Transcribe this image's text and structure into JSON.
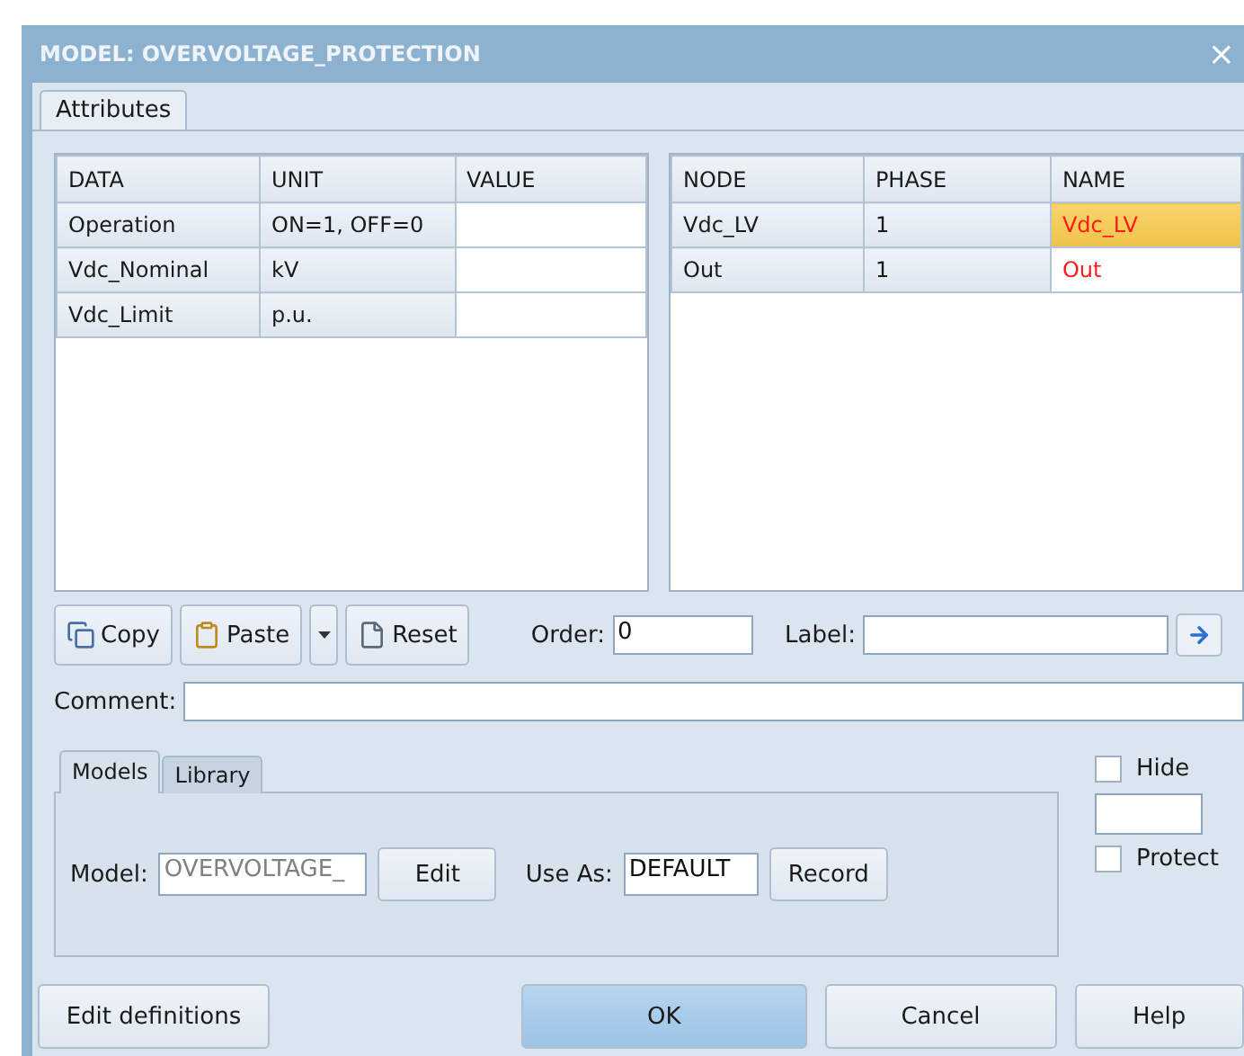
{
  "window": {
    "title": "MODEL: OVERVOLTAGE_PROTECTION",
    "close": "×"
  },
  "tabs": [
    {
      "label": "Attributes",
      "selected": true
    }
  ],
  "data_table": {
    "columns": [
      "DATA",
      "UNIT",
      "VALUE"
    ],
    "rows": [
      {
        "data": "Operation",
        "unit": "ON=1, OFF=0"
      },
      {
        "data": "Vdc_Nominal",
        "unit": "kV"
      },
      {
        "data": "Vdc_Limit",
        "unit": "p.u."
      }
    ]
  },
  "node_table": {
    "columns": [
      "NODE",
      "PHASE",
      "NAME"
    ],
    "rows": [
      {
        "node": "Vdc_LV",
        "phase": "1",
        "name": "Vdc_LV",
        "selected": true
      },
      {
        "node": "Out",
        "phase": "1",
        "name": "Out",
        "selected": false
      }
    ]
  },
  "toolbar": {
    "buttons": [
      {
        "kind": "copy",
        "label": "Copy"
      },
      {
        "kind": "paste",
        "label": "Paste"
      },
      {
        "kind": "dropdown"
      },
      {
        "kind": "reset",
        "label": "Reset"
      }
    ],
    "order": {
      "label": "Order:",
      "value": "0"
    },
    "label_field": {
      "label": "Label:"
    }
  },
  "comment": {
    "label": "Comment:"
  },
  "sub_tabs": [
    {
      "label": "Models",
      "selected": true
    },
    {
      "label": "Library",
      "selected": false
    }
  ],
  "models": {
    "model": {
      "label": "Model:",
      "value": "OVERVOLTAGE_",
      "disabled": true
    },
    "edit": {
      "label": "Edit"
    },
    "use_as": {
      "label": "Use As:",
      "value": "DEFAULT"
    },
    "record": {
      "label": "Record"
    }
  },
  "options": [
    {
      "label": "Hide",
      "checked": false
    },
    {
      "label": "Protect",
      "checked": false
    }
  ],
  "footer": [
    {
      "label": "Edit definitions",
      "default": false
    },
    {
      "label": "OK",
      "default": true
    },
    {
      "label": "Cancel",
      "default": false
    },
    {
      "label": "Help",
      "default": false
    }
  ]
}
